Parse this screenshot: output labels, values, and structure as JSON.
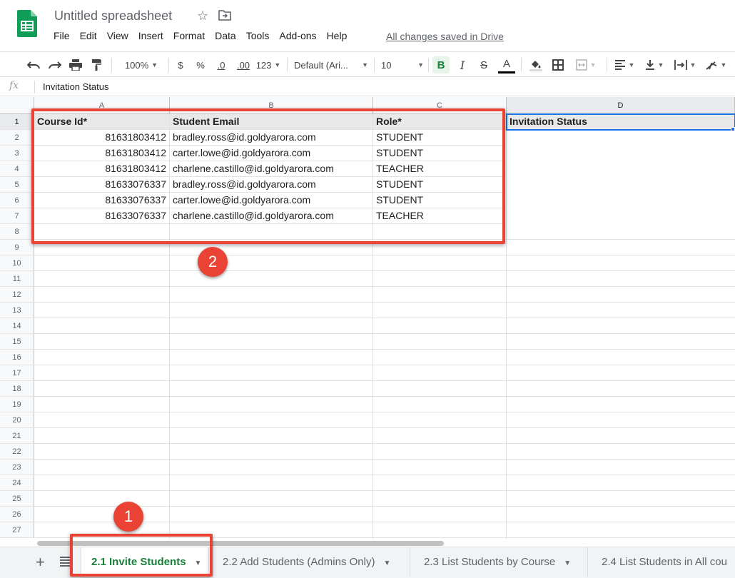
{
  "app": {
    "title": "Untitled spreadsheet",
    "saved_status": "All changes saved in Drive"
  },
  "menu": [
    "File",
    "Edit",
    "View",
    "Insert",
    "Format",
    "Data",
    "Tools",
    "Add-ons",
    "Help"
  ],
  "toolbar": {
    "zoom": "100%",
    "currency": "$",
    "percent": "%",
    "decrease_decimals": ".0",
    "increase_decimals": ".00",
    "more_formats": "123",
    "font": "Default (Ari...",
    "font_size": "10",
    "bold": "B",
    "italic": "I",
    "strikethrough": "S",
    "text_color": "A"
  },
  "formula_bar": {
    "fx": "fx",
    "value": "Invitation Status"
  },
  "columns": [
    "A",
    "B",
    "C",
    "D"
  ],
  "rows": [
    "1",
    "2",
    "3",
    "4",
    "5",
    "6",
    "7",
    "8",
    "9",
    "10",
    "11",
    "12",
    "13",
    "14",
    "15",
    "16",
    "17",
    "18",
    "19",
    "20",
    "21",
    "22",
    "23",
    "24",
    "25",
    "26",
    "27"
  ],
  "sheet": {
    "headers": [
      "Course Id*",
      "Student Email",
      "Role*",
      "Invitation Status"
    ],
    "data": [
      [
        "81631803412",
        "bradley.ross@id.goldyarora.com",
        "STUDENT"
      ],
      [
        "81631803412",
        "carter.lowe@id.goldyarora.com",
        "STUDENT"
      ],
      [
        "81631803412",
        "charlene.castillo@id.goldyarora.com",
        "TEACHER"
      ],
      [
        "81633076337",
        "bradley.ross@id.goldyarora.com",
        "STUDENT"
      ],
      [
        "81633076337",
        "carter.lowe@id.goldyarora.com",
        "STUDENT"
      ],
      [
        "81633076337",
        "charlene.castillo@id.goldyarora.com",
        "TEACHER"
      ]
    ]
  },
  "annotations": {
    "badge_1": "1",
    "badge_2": "2",
    "highlight_color": "#ea4335"
  },
  "tabs": [
    {
      "label": "2.1 Invite Students",
      "active": true
    },
    {
      "label": "2.2 Add Students (Admins Only)",
      "active": false
    },
    {
      "label": "2.3 List Students by Course",
      "active": false
    },
    {
      "label": "2.4 List Students in All cou",
      "active": false
    }
  ],
  "colors": {
    "accent_green": "#188038",
    "selection_blue": "#1a73e8",
    "sheets_logo": "#0f9d58"
  }
}
